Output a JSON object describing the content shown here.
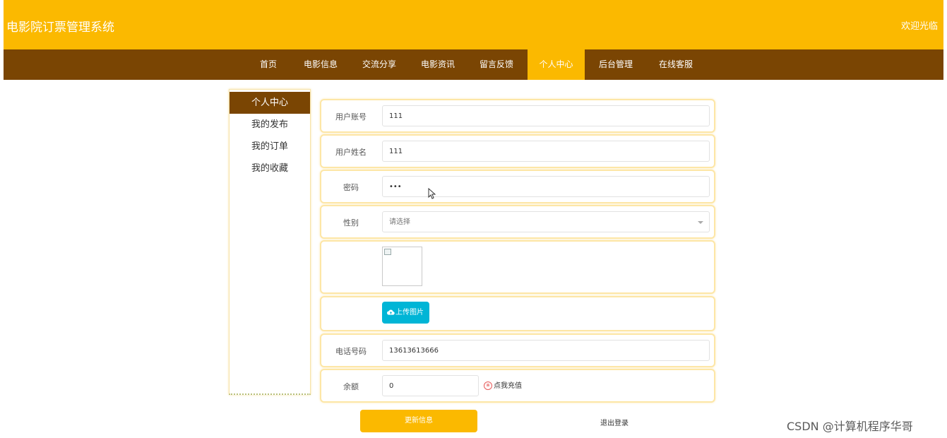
{
  "header": {
    "title": "电影院订票管理系统",
    "welcome": "欢迎光临"
  },
  "nav": {
    "active_index": 5,
    "items": [
      "首页",
      "电影信息",
      "交流分享",
      "电影资讯",
      "留言反馈",
      "个人中心",
      "后台管理",
      "在线客服"
    ]
  },
  "sidebar": {
    "items": [
      "个人中心",
      "我的发布",
      "我的订单",
      "我的收藏"
    ]
  },
  "form": {
    "username": {
      "label": "用户账号",
      "value": "111"
    },
    "name": {
      "label": "用户姓名",
      "value": "111"
    },
    "password": {
      "label": "密码",
      "value": "•••"
    },
    "gender": {
      "label": "性别",
      "placeholder": "请选择"
    },
    "upload_label": "上传图片",
    "phone": {
      "label": "电话号码",
      "value": "13613613666"
    },
    "balance": {
      "label": "余额",
      "value": "0",
      "recharge_label": "点我充值"
    }
  },
  "actions": {
    "update_label": "更新信息",
    "logout_label": "退出登录"
  },
  "watermark": "CSDN @计算机程序华哥",
  "colors": {
    "header_bg": "#fbb900",
    "nav_bg": "#7a4503",
    "accent": "#fbb900",
    "upload_button": "#00b5d6"
  },
  "icons": {
    "upload": "cloud-upload-icon",
    "recharge": "recharge-icon",
    "select_caret": "chevron-down-icon"
  }
}
